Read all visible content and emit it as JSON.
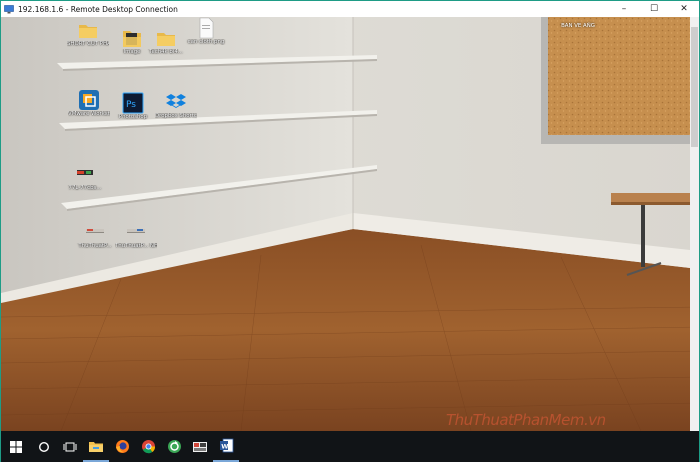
{
  "window": {
    "title": "192.168.1.6 - Remote Desktop Connection"
  },
  "controls": {
    "minimize": "–",
    "maximize": "☐",
    "close": "✕"
  },
  "corkboard": {
    "note": "BAN VE AÑG"
  },
  "desktop_icons": [
    {
      "label": "SHORT CUT PHẦN MỀ...",
      "icon": "folder-icon"
    },
    {
      "label": "Image",
      "icon": "folder-icon"
    },
    {
      "label": "Tech4k bi4...",
      "icon": "folder-icon"
    },
    {
      "label": "can cloth.png",
      "icon": "document-icon"
    },
    {
      "label": "VMware Workstati...",
      "icon": "vmware-icon"
    },
    {
      "label": "Photoshop",
      "icon": "photoshop-icon"
    },
    {
      "label": "Dropbox Shortcut",
      "icon": "dropbox-icon"
    },
    {
      "label": "77L-77cbs...",
      "icon": "image-file-icon"
    },
    {
      "label": "ThuThuatP...",
      "icon": "image-file-icon"
    },
    {
      "label": "ThuThuatP... NHH.png",
      "icon": "image-file-icon"
    }
  ],
  "taskbar": {
    "items": [
      "windows-start-icon",
      "cortana-icon",
      "task-view-icon",
      "file-explorer-icon",
      "firefox-icon",
      "chrome-icon",
      "green-app-icon",
      "gallery-app-icon",
      "word-icon"
    ]
  },
  "watermark": "ThuThuatPhanMem.vn"
}
